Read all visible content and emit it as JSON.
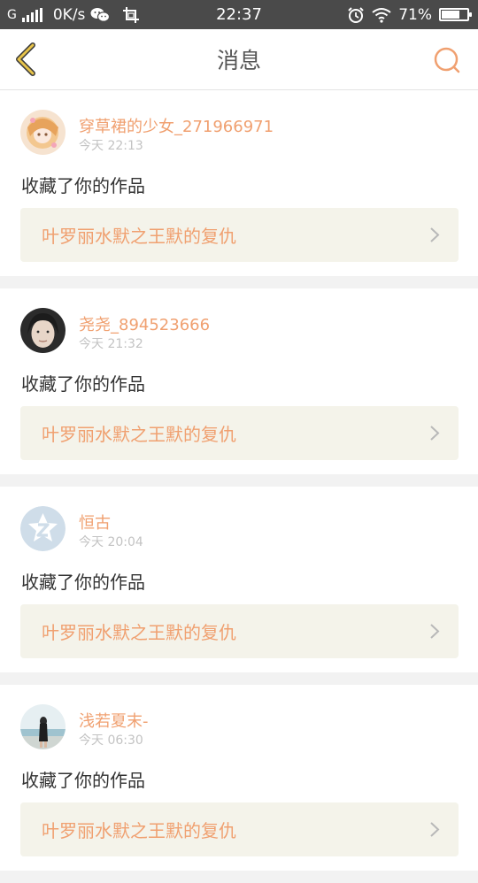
{
  "status_bar": {
    "network": "G",
    "speed": "0K/s",
    "time": "22:37",
    "battery": "71%",
    "battery_level": 0.71
  },
  "header": {
    "title": "消息",
    "back_icon": "back-chevron-icon",
    "search_icon": "search-icon"
  },
  "colors": {
    "accent": "#f0a070",
    "back_arrow": "#e8c44a",
    "work_box_bg": "#f4f3ea",
    "status_bar_bg": "#4a4a4a"
  },
  "messages": [
    {
      "username": "穿草裙的少女_271966971",
      "time": "今天 22:13",
      "action": "收藏了你的作品",
      "work": "叶罗丽水默之王默的复仇"
    },
    {
      "username": "尧尧_894523666",
      "time": "今天 21:32",
      "action": "收藏了你的作品",
      "work": "叶罗丽水默之王默的复仇"
    },
    {
      "username": "恒古",
      "time": "今天 20:04",
      "action": "收藏了你的作品",
      "work": "叶罗丽水默之王默的复仇"
    },
    {
      "username": "浅若夏末-",
      "time": "今天 06:30",
      "action": "收藏了你的作品",
      "work": "叶罗丽水默之王默的复仇"
    }
  ]
}
